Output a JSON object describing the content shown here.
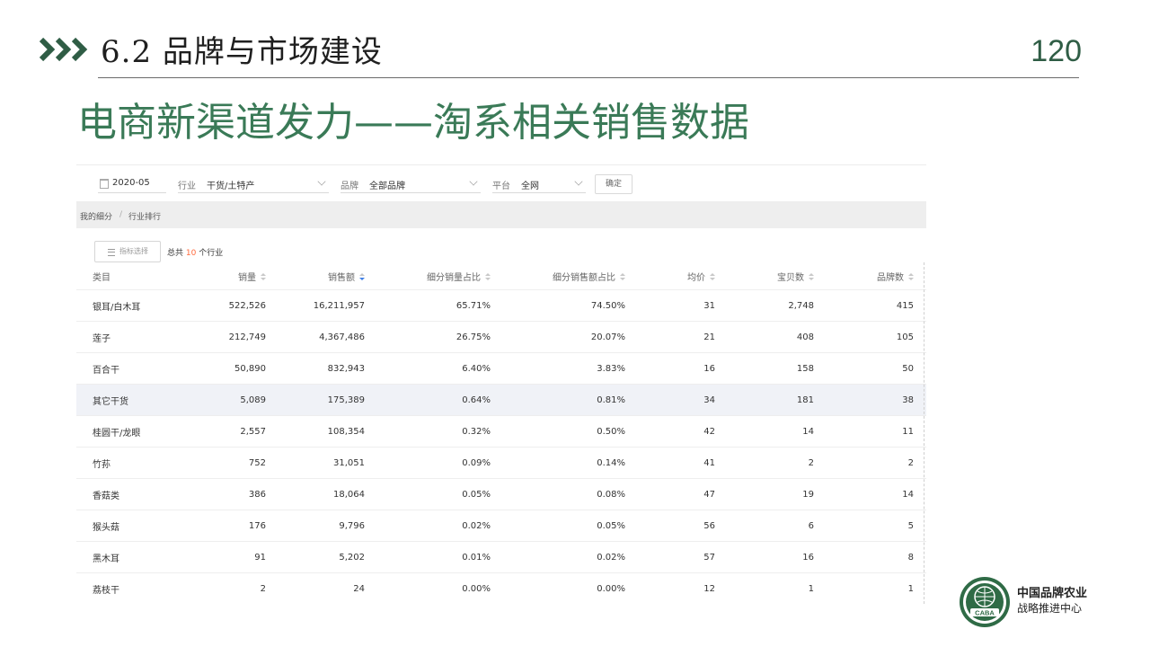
{
  "slide": {
    "section_title": "6.2 品牌与市场建设",
    "page_number": "120",
    "main_title": "电商新渠道发力——淘系相关销售数据",
    "accent_color": "#3a7a57",
    "logo": {
      "name": "CABA",
      "line1": "中国品牌农业",
      "line2": "战略推进中心"
    }
  },
  "filters": {
    "date": "2020-05",
    "industry_label": "行业",
    "industry_value": "干货/土特产",
    "brand_label": "品牌",
    "brand_value": "全部品牌",
    "platform_label": "平台",
    "platform_value": "全网",
    "confirm_label": "确定"
  },
  "breadcrumb": {
    "item1": "我的细分",
    "sep": "/",
    "item2": "行业排行"
  },
  "toolbar": {
    "metric_button": "指标选择",
    "total_prefix": "总共",
    "total_count": "10",
    "total_suffix": "个行业"
  },
  "table": {
    "headers": [
      "类目",
      "销量",
      "销售额",
      "细分销量占比",
      "细分销售额占比",
      "均价",
      "宝贝数",
      "品牌数"
    ],
    "rows": [
      [
        "银耳/白木耳",
        "522,526",
        "16,211,957",
        "65.71%",
        "74.50%",
        "31",
        "2,748",
        "415"
      ],
      [
        "莲子",
        "212,749",
        "4,367,486",
        "26.75%",
        "20.07%",
        "21",
        "408",
        "105"
      ],
      [
        "百合干",
        "50,890",
        "832,943",
        "6.40%",
        "3.83%",
        "16",
        "158",
        "50"
      ],
      [
        "其它干货",
        "5,089",
        "175,389",
        "0.64%",
        "0.81%",
        "34",
        "181",
        "38"
      ],
      [
        "桂圆干/龙眼",
        "2,557",
        "108,354",
        "0.32%",
        "0.50%",
        "42",
        "14",
        "11"
      ],
      [
        "竹荪",
        "752",
        "31,051",
        "0.09%",
        "0.14%",
        "41",
        "2",
        "2"
      ],
      [
        "香菇类",
        "386",
        "18,064",
        "0.05%",
        "0.08%",
        "47",
        "19",
        "14"
      ],
      [
        "猴头菇",
        "176",
        "9,796",
        "0.02%",
        "0.05%",
        "56",
        "6",
        "5"
      ],
      [
        "黑木耳",
        "91",
        "5,202",
        "0.01%",
        "0.02%",
        "57",
        "16",
        "8"
      ],
      [
        "荔枝干",
        "2",
        "24",
        "0.00%",
        "0.00%",
        "12",
        "1",
        "1"
      ]
    ]
  }
}
